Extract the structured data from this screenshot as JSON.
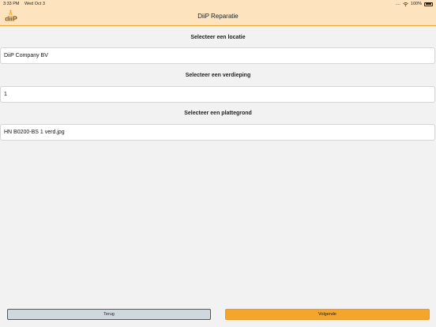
{
  "status_bar": {
    "time": "3:33 PM",
    "date": "Wed Oct 3",
    "signal": "....",
    "battery": "100%"
  },
  "header": {
    "title": "DiiP Reparatie",
    "logo_text": "diiP",
    "accent_color": "#f5a52b",
    "background_color": "#fde4bf"
  },
  "form": {
    "location_label": "Selecteer een locatie",
    "location_value": "DiiP Company BV",
    "floor_label": "Selecteer een verdieping",
    "floor_value": "1",
    "floorplan_label": "Selecteer een plattegrond",
    "floorplan_value": "HN B0200-BS 1 verd.jpg"
  },
  "footer": {
    "back_label": "Terug",
    "next_label": "Volgende"
  }
}
